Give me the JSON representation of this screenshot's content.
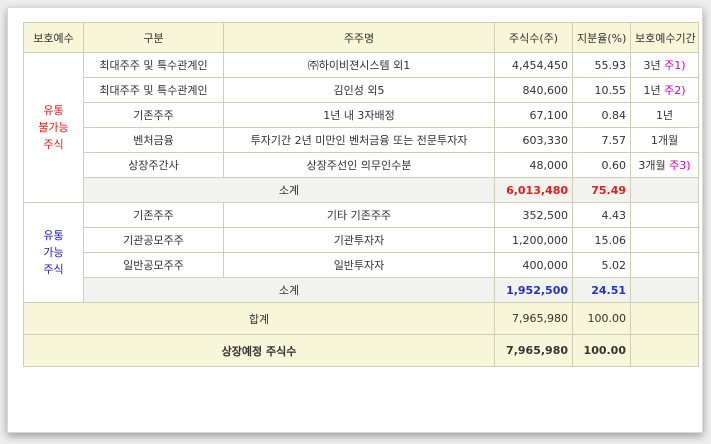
{
  "headers": [
    "보호예수",
    "구분",
    "주주명",
    "주식수(주)",
    "지분율(%)",
    "보호예수기간"
  ],
  "restricted": {
    "label_lines": [
      "유통",
      "불가능",
      "주식"
    ],
    "color": "#e02020",
    "rows": [
      {
        "category": "최대주주 및 특수관계인",
        "holder": "㈜하이비젼시스템 외1",
        "shares": "4,454,450",
        "ratio": "55.93",
        "period": "3년",
        "note": "주1)"
      },
      {
        "category": "최대주주 및 특수관계인",
        "holder": "김인성 외5",
        "shares": "840,600",
        "ratio": "10.55",
        "period": "1년",
        "note": "주2)"
      },
      {
        "category": "기존주주",
        "holder": "1년 내 3자배정",
        "shares": "67,100",
        "ratio": "0.84",
        "period": "1년",
        "note": ""
      },
      {
        "category": "벤처금융",
        "holder": "투자기간 2년 미만인 벤처금융 또는 전문투자자",
        "shares": "603,330",
        "ratio": "7.57",
        "period": "1개월",
        "note": ""
      },
      {
        "category": "상장주간사",
        "holder": "상장주선인 의무인수분",
        "shares": "48,000",
        "ratio": "0.60",
        "period": "3개월",
        "note": "주3)"
      }
    ],
    "subtotal": {
      "label": "소계",
      "shares": "6,013,480",
      "ratio": "75.49"
    }
  },
  "tradable": {
    "label_lines": [
      "유통",
      "가능",
      "주식"
    ],
    "color": "#2020c0",
    "rows": [
      {
        "category": "기존주주",
        "holder": "기타 기존주주",
        "shares": "352,500",
        "ratio": "4.43",
        "period": "",
        "note": ""
      },
      {
        "category": "기관공모주주",
        "holder": "기관투자자",
        "shares": "1,200,000",
        "ratio": "15.06",
        "period": "",
        "note": ""
      },
      {
        "category": "일반공모주주",
        "holder": "일반투자자",
        "shares": "400,000",
        "ratio": "5.02",
        "period": "",
        "note": ""
      }
    ],
    "subtotal": {
      "label": "소계",
      "shares": "1,952,500",
      "ratio": "24.51"
    }
  },
  "total": {
    "label": "합계",
    "shares": "7,965,980",
    "ratio": "100.00"
  },
  "grand_total": {
    "label": "상장예정 주식수",
    "shares": "7,965,980",
    "ratio": "100.00"
  }
}
